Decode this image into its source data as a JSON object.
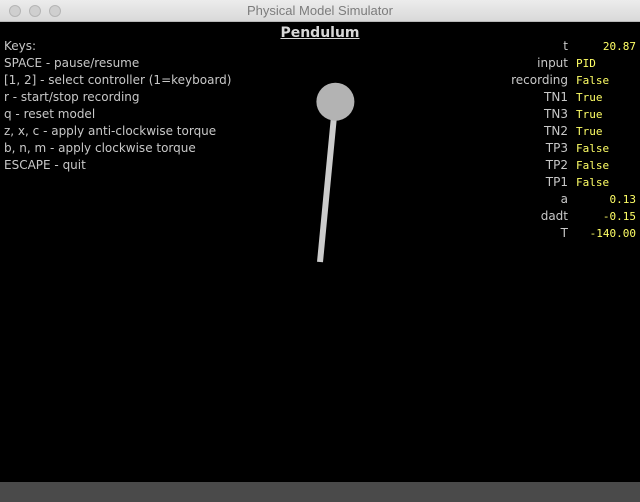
{
  "window": {
    "title": "Physical Model Simulator"
  },
  "simulation": {
    "title": "Pendulum",
    "pendulum_angle_deg": 5.5
  },
  "keys": [
    "Keys:",
    "SPACE - pause/resume",
    "[1, 2] - select controller (1=keyboard)",
    "r - start/stop recording",
    "q - reset model",
    "z, x, c - apply anti-clockwise torque",
    "b, n, m - apply clockwise torque",
    "ESCAPE - quit"
  ],
  "status": [
    {
      "key": "t",
      "value": "20.87",
      "align": "num"
    },
    {
      "key": "input",
      "value": "PID",
      "align": "txt"
    },
    {
      "key": "recording",
      "value": "False",
      "align": "txt"
    },
    {
      "key": "TN1",
      "value": "True",
      "align": "txt"
    },
    {
      "key": "TN3",
      "value": "True",
      "align": "txt"
    },
    {
      "key": "TN2",
      "value": "True",
      "align": "txt"
    },
    {
      "key": "TP3",
      "value": "False",
      "align": "txt"
    },
    {
      "key": "TP2",
      "value": "False",
      "align": "txt"
    },
    {
      "key": "TP1",
      "value": "False",
      "align": "txt"
    },
    {
      "key": "a",
      "value": "0.13",
      "align": "num"
    },
    {
      "key": "dadt",
      "value": "-0.15",
      "align": "num"
    },
    {
      "key": "T",
      "value": "-140.00",
      "align": "num"
    }
  ],
  "colors": {
    "background": "#000000",
    "pendulum": "#cccccc",
    "status_value": "#ffff66",
    "text": "#c8c8c8"
  }
}
